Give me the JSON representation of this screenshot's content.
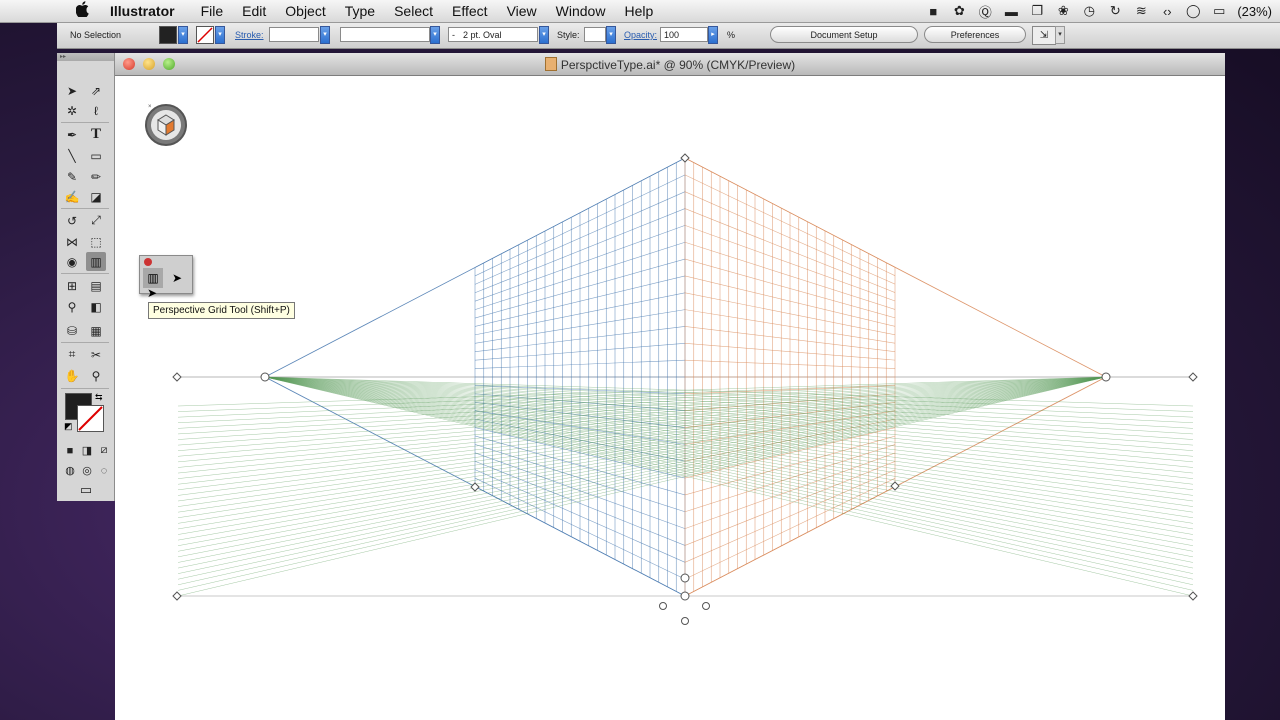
{
  "menubar": {
    "apple": "",
    "app": "Illustrator",
    "items": [
      "File",
      "Edit",
      "Object",
      "Type",
      "Select",
      "Effect",
      "View",
      "Window",
      "Help"
    ],
    "battery": "(23%)"
  },
  "controlbar": {
    "selection": "No Selection",
    "stroke_label": "Stroke:",
    "brush_dash": "-",
    "brush": "2 pt. Oval",
    "style_label": "Style:",
    "opacity_label": "Opacity:",
    "opacity_value": "100",
    "percent": "%",
    "doc_setup": "Document Setup",
    "preferences": "Preferences"
  },
  "document": {
    "title": "PerspctiveType.ai* @ 90% (CMYK/Preview)"
  },
  "tooltip": "Perspective Grid Tool (Shift+P)",
  "colors": {
    "left_grid": "#4a7ab0",
    "right_grid": "#d98a5a",
    "ground_grid": "#5a9a5a",
    "horizon": "#888888"
  }
}
